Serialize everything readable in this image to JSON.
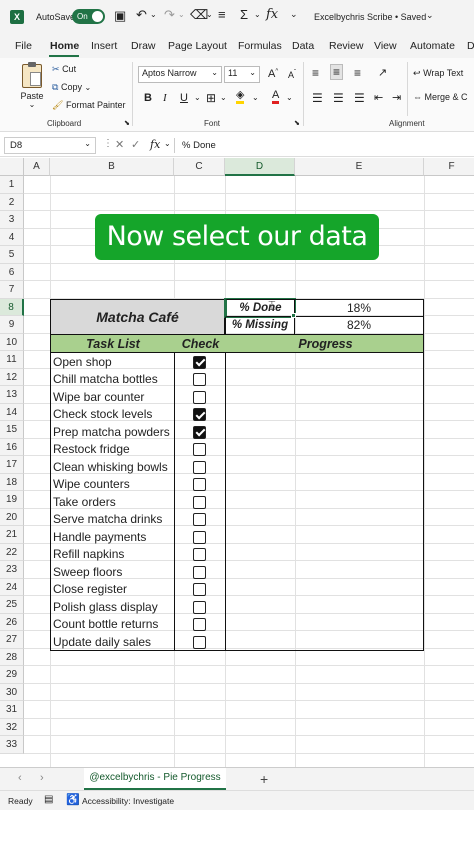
{
  "titlebar": {
    "autosave_label": "AutoSave",
    "autosave_state": "On",
    "workbook_title": "Excelbychris Scribe • Saved",
    "accent": "#217346"
  },
  "menu_tabs": [
    "File",
    "Home",
    "Insert",
    "Draw",
    "Page Layout",
    "Formulas",
    "Data",
    "Review",
    "View",
    "Automate",
    "D"
  ],
  "ribbon": {
    "paste": "Paste",
    "cut": "Cut",
    "copy": "Copy",
    "format_painter": "Format Painter",
    "clipboard_label": "Clipboard",
    "font_name": "Aptos Narrow",
    "font_size": "11",
    "font_label": "Font",
    "wrap_text": "Wrap Text",
    "merge": "Merge & C",
    "alignment_label": "Alignment"
  },
  "formula_bar": {
    "name_box": "D8",
    "fx": "fx",
    "formula": "% Done"
  },
  "columns": [
    "A",
    "B",
    "C",
    "D",
    "E",
    "F"
  ],
  "rows": [
    "1",
    "2",
    "3",
    "4",
    "5",
    "6",
    "7",
    "8",
    "9",
    "10",
    "11",
    "12",
    "13",
    "14",
    "15",
    "16",
    "17",
    "18",
    "19",
    "20",
    "21",
    "22",
    "23",
    "24",
    "25",
    "26",
    "27",
    "28",
    "29",
    "30",
    "31",
    "32",
    "33"
  ],
  "overlay_caption": "Now select our data",
  "sheet": {
    "title": "Matcha Café",
    "done_label": "% Done",
    "done_value": "18%",
    "missing_label": "% Missing",
    "missing_value": "82%",
    "header_task": "Task List",
    "header_check": "Check",
    "header_progress": "Progress",
    "header_color": "#a9d08e",
    "tasks": [
      {
        "name": "Open shop",
        "checked": true
      },
      {
        "name": "Chill matcha bottles",
        "checked": false
      },
      {
        "name": "Wipe bar counter",
        "checked": false
      },
      {
        "name": "Check stock levels",
        "checked": true
      },
      {
        "name": "Prep matcha powders",
        "checked": true
      },
      {
        "name": "Restock fridge",
        "checked": false
      },
      {
        "name": "Clean whisking bowls",
        "checked": false
      },
      {
        "name": "Wipe counters",
        "checked": false
      },
      {
        "name": "Take orders",
        "checked": false
      },
      {
        "name": "Serve matcha drinks",
        "checked": false
      },
      {
        "name": "Handle payments",
        "checked": false
      },
      {
        "name": "Refill napkins",
        "checked": false
      },
      {
        "name": "Sweep floors",
        "checked": false
      },
      {
        "name": "Close register",
        "checked": false
      },
      {
        "name": "Polish glass display",
        "checked": false
      },
      {
        "name": "Count bottle returns",
        "checked": false
      },
      {
        "name": "Update daily sales",
        "checked": false
      }
    ]
  },
  "sheet_tab": "@excelbychris - Pie Progress",
  "add_sheet": "+",
  "status": {
    "ready": "Ready",
    "accessibility": "Accessibility: Investigate"
  }
}
